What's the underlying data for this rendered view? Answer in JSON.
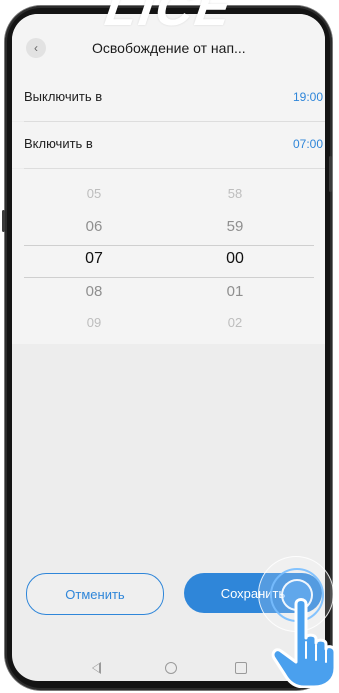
{
  "watermark": "LICE",
  "header": {
    "title": "Освобождение от нап..."
  },
  "settings": [
    {
      "label": "Выключить в",
      "value": "19:00"
    },
    {
      "label": "Включить в",
      "value": "07:00"
    }
  ],
  "picker": {
    "hours": [
      "05",
      "06",
      "07",
      "08",
      "09"
    ],
    "minutes": [
      "58",
      "59",
      "00",
      "01",
      "02"
    ],
    "selected_hour": "07",
    "selected_minute": "00"
  },
  "buttons": {
    "cancel": "Отменить",
    "save": "Сохранить"
  },
  "colors": {
    "accent": "#2f86d9",
    "background": "#ededed",
    "panel": "#f4f4f4"
  },
  "icons": [
    "back-icon",
    "nav-back-icon",
    "nav-home-icon",
    "nav-recent-icon",
    "hand-tap-icon"
  ]
}
